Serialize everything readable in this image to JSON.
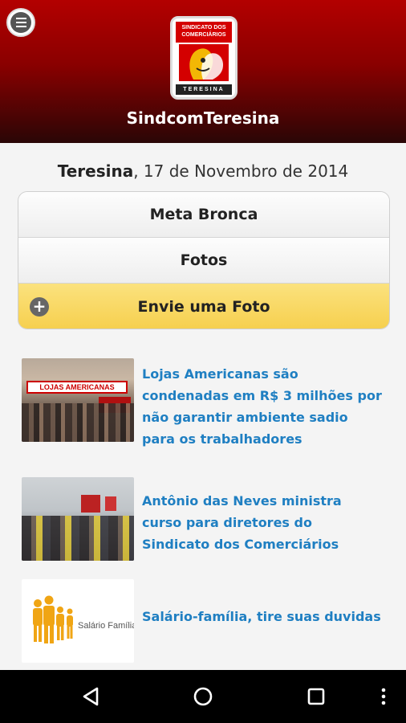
{
  "header": {
    "app_title": "SindcomTeresina",
    "menu_icon": "menu-icon",
    "logo": {
      "top_text": "SINDICATO DOS COMERCIÁRIOS",
      "bottom_text": "TERESINA",
      "colors": {
        "red": "#d40000",
        "dark": "#222222"
      }
    }
  },
  "date": {
    "city": "Teresina",
    "rest": ", 17 de Novembro de 2014"
  },
  "buttons": [
    {
      "label": "Meta Bronca"
    },
    {
      "label": "Fotos"
    },
    {
      "label": "Envie uma Foto",
      "icon": "plus-circle-icon"
    }
  ],
  "news": [
    {
      "title": "Lojas Americanas são condenadas em R$ 3 milhões por não garantir ambiente sadio para os trabalhadores",
      "thumb_sign": "LOJAS AMERICANAS"
    },
    {
      "title": "Antônio das Neves ministra curso para diretores do Sindicato dos Comerciários"
    },
    {
      "title": "Salário-família, tire suas duvidas",
      "thumb_caption": "Salário Família"
    }
  ],
  "navbar": {
    "icons": [
      "back-icon",
      "home-icon",
      "recent-apps-icon",
      "overflow-menu-icon"
    ]
  },
  "colors": {
    "header_top": "#b30000",
    "header_bottom": "#2a0606",
    "link": "#1f7fc2",
    "highlight_button": "#f6cf4d"
  }
}
